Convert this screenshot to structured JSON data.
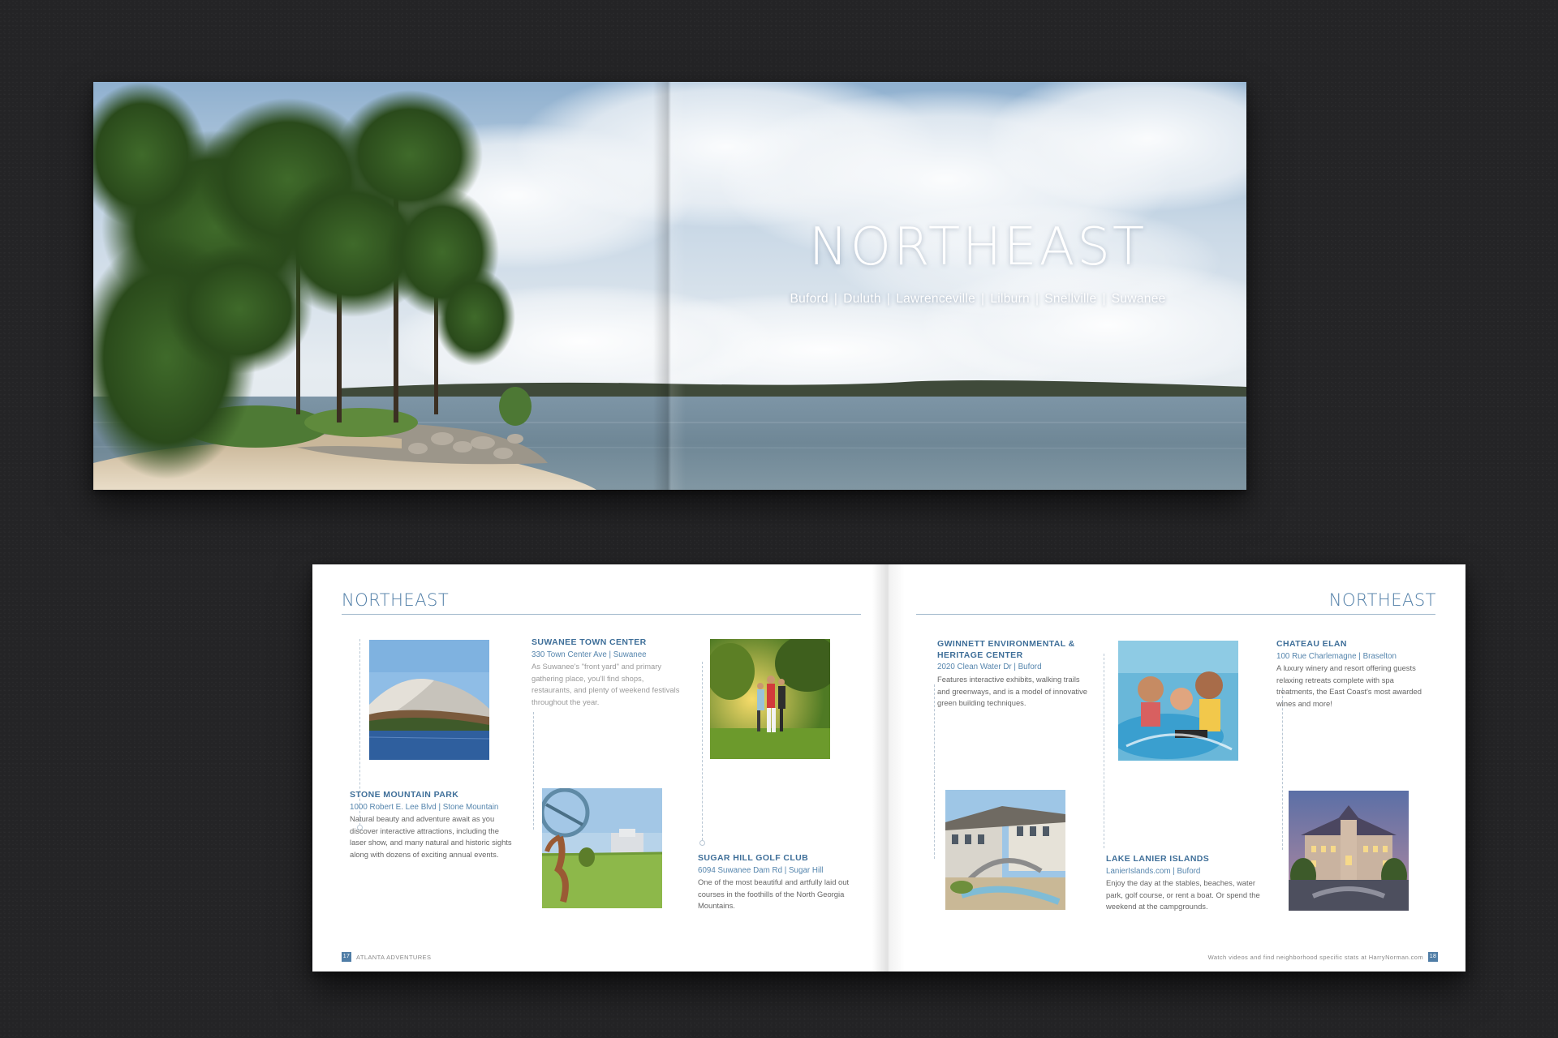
{
  "hero": {
    "title": "NORTHEAST",
    "cities": [
      "Buford",
      "Duluth",
      "Lawrenceville",
      "Lilburn",
      "Snellville",
      "Suwanee"
    ],
    "separator": "|"
  },
  "left_page": {
    "heading": "NORTHEAST",
    "entries": [
      {
        "name": "SUWANEE TOWN CENTER",
        "address": "330 Town Center Ave  |  Suwanee",
        "description": "As Suwanee's \"front yard\" and primary gathering place, you'll find shops, restaurants, and plenty of weekend festivals throughout the year."
      },
      {
        "name": "STONE MOUNTAIN PARK",
        "address": "1000 Robert E. Lee Blvd  |  Stone Mountain",
        "description": "Natural beauty and adventure await as you discover interactive attractions, including the laser show, and many natural and historic sights along with dozens of exciting annual events."
      },
      {
        "name": "SUGAR HILL GOLF CLUB",
        "address": "6094 Suwanee Dam Rd  |  Sugar Hill",
        "description": "One of the most beautiful and artfully laid out courses in the foothills of the North Georgia Mountains."
      }
    ],
    "folio_number": "17",
    "folio_text": "ATLANTA ADVENTURES"
  },
  "right_page": {
    "heading": "NORTHEAST",
    "entries": [
      {
        "name": "GWINNETT ENVIRONMENTAL & HERITAGE CENTER",
        "address": "2020 Clean Water Dr  |  Buford",
        "description": "Features interactive exhibits, walking trails and greenways, and is a model of innovative green building techniques."
      },
      {
        "name": "CHATEAU ELAN",
        "address": "100 Rue Charlemagne  |  Braselton",
        "description": "A luxury winery and resort offering guests relaxing retreats complete with spa treatments, the East Coast's most awarded wines and more!"
      },
      {
        "name": "LAKE LANIER ISLANDS",
        "address": "LanierIslands.com  |  Buford",
        "description": "Enjoy the day at the stables, beaches, water park, golf course, or rent a boat. Or spend the weekend at the campgrounds."
      }
    ],
    "folio_number": "18",
    "folio_text": "Watch videos and find neighborhood specific stats at HarryNorman.com"
  }
}
